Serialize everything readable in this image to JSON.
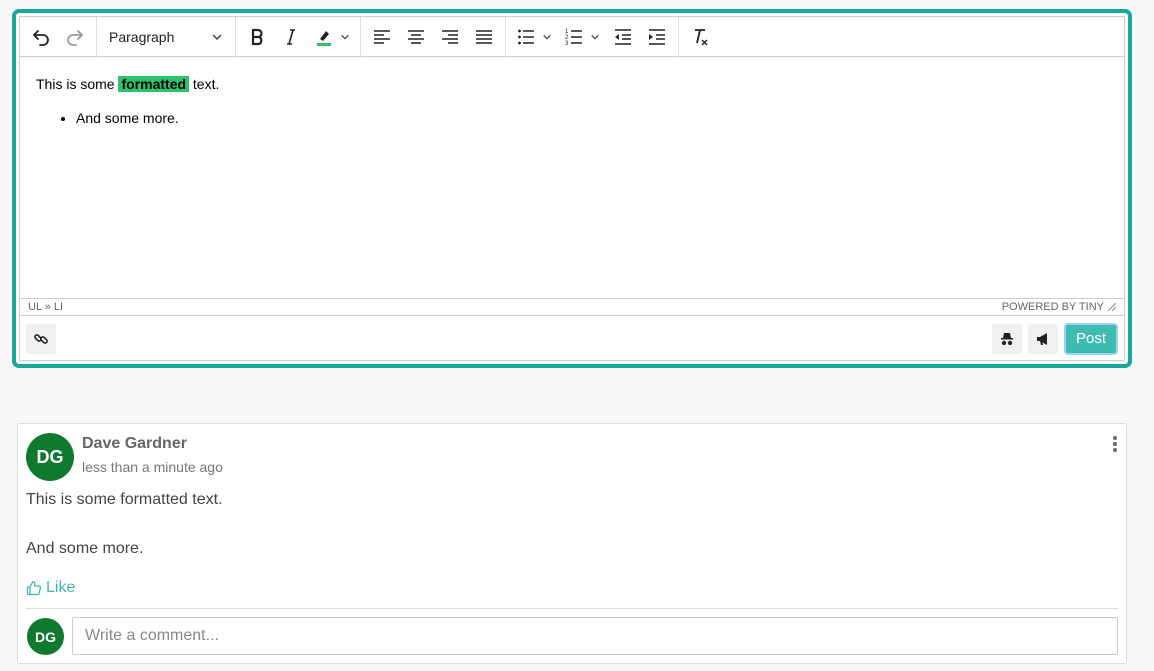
{
  "editor": {
    "format_value": "Paragraph",
    "content": {
      "line1_before": "This is some ",
      "line1_highlight": "formatted",
      "line1_after": " text.",
      "list_items": [
        "And some more."
      ]
    },
    "highlight_color": "#2dc26b",
    "statusbar": {
      "path": "UL » LI",
      "branding": "POWERED BY TINY"
    },
    "post_label": "Post",
    "accent_color": "#17a89a"
  },
  "post": {
    "author_initials": "DG",
    "author_name": "Dave Gardner",
    "time": "less than a minute ago",
    "body_line1": "This is some formatted text.",
    "body_line2": "And some more.",
    "like_label": "Like",
    "commenter_initials": "DG",
    "comment_placeholder": "Write a comment...",
    "avatar_color": "#0f7a2e"
  }
}
